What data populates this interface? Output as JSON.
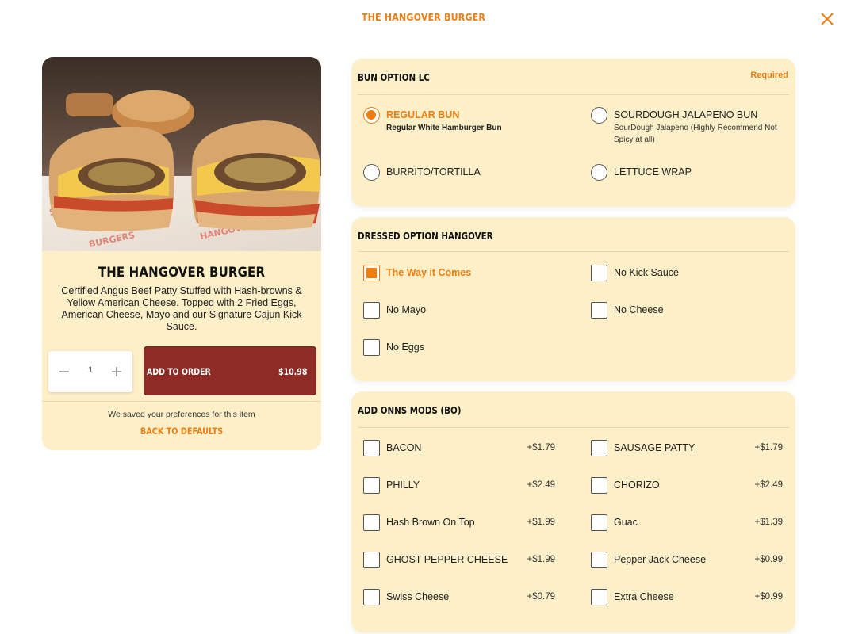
{
  "header": {
    "title": "THE HANGOVER BURGER",
    "close_icon": "close-icon"
  },
  "colors": {
    "accent": "#ee7d12",
    "panel_bg": "#fdefc8",
    "add_button": "#8e2b24"
  },
  "product": {
    "name": "THE HANGOVER BURGER",
    "description": "Certified Angus Beef Patty Stuffed with Hash-browns & Yellow American Cheese. Topped with 2 Fried Eggs, American Cheese, Mayo and our Signature Cajun Kick Sauce.",
    "quantity": "1",
    "add_label": "ADD TO ORDER",
    "price": "$10.98",
    "saved_note": "We saved your preferences for this item",
    "back_defaults": "BACK TO DEFAULTS"
  },
  "bun": {
    "title": "BUN OPTION LC",
    "required": "Required",
    "options": [
      {
        "label": "REGULAR BUN",
        "sub": "Regular White Hamburger Bun",
        "selected": true
      },
      {
        "label": "SOURDOUGH JALAPENO BUN",
        "sub": "SourDough Jalapeno (Highly Recommend Not Spicy at all)",
        "selected": false
      },
      {
        "label": "BURRITO/TORTILLA",
        "selected": false
      },
      {
        "label": "LETTUCE WRAP",
        "selected": false
      }
    ]
  },
  "dressed": {
    "title": "DRESSED OPTION HANGOVER",
    "options": [
      {
        "label": "The Way it Comes",
        "checked": true
      },
      {
        "label": "No Kick Sauce",
        "checked": false
      },
      {
        "label": "No Mayo",
        "checked": false
      },
      {
        "label": "No Cheese",
        "checked": false
      },
      {
        "label": "No Eggs",
        "checked": false
      }
    ]
  },
  "addons": {
    "title": "ADD ONNS MODS (BO)",
    "options": [
      {
        "label": "BACON",
        "price": "+$1.79"
      },
      {
        "label": "SAUSAGE PATTY",
        "price": "+$1.79"
      },
      {
        "label": "PHILLY",
        "price": "+$2.49"
      },
      {
        "label": "CHORIZO",
        "price": "+$2.49"
      },
      {
        "label": "Hash Brown On Top",
        "price": "+$1.99"
      },
      {
        "label": "Guac",
        "price": "+$1.39"
      },
      {
        "label": "GHOST PEPPER CHEESE",
        "price": "+$1.99"
      },
      {
        "label": "Pepper Jack Cheese",
        "price": "+$0.99"
      },
      {
        "label": "Swiss Cheese",
        "price": "+$0.79"
      },
      {
        "label": "Extra Cheese",
        "price": "+$0.99"
      }
    ]
  }
}
